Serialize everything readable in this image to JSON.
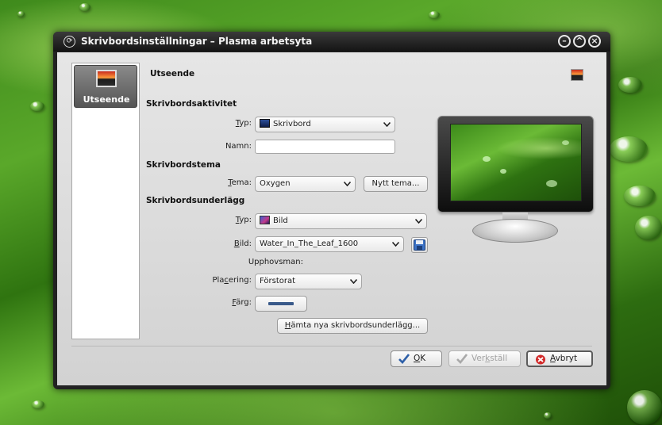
{
  "window": {
    "title": "Skrivbordsinställningar – Plasma arbetsyta",
    "controls": [
      "minimize",
      "maximize",
      "close"
    ]
  },
  "sidebar": {
    "items": [
      {
        "label": "Utseende",
        "icon": "monitor-sunset-icon",
        "selected": true
      }
    ]
  },
  "page": {
    "heading": "Utseende"
  },
  "activity": {
    "section": "Skrivbordsaktivitet",
    "type_label_u": "T",
    "type_label_rest": "yp:",
    "type_value": "Skrivbord",
    "name_label": "Namn:",
    "name_value": ""
  },
  "theme": {
    "section": "Skrivbordstema",
    "theme_label_u": "T",
    "theme_label_rest": "ema:",
    "theme_value": "Oxygen",
    "new_theme_button": "Nytt tema..."
  },
  "wallpaper": {
    "section": "Skrivbordsunderlägg",
    "type_label_u": "T",
    "type_label_rest": "yp:",
    "type_value": "Bild",
    "image_label_u": "B",
    "image_label_rest": "ild:",
    "image_value": "Water_In_The_Leaf_1600",
    "author_label": "Upphovsman:",
    "author_value": "",
    "placement_label_before": "Pla",
    "placement_label_u": "c",
    "placement_label_after": "ering:",
    "placement_value": "Förstorat",
    "color_label_u": "F",
    "color_label_rest": "ärg:",
    "color_value": "#3a5a8a",
    "get_new_button_u": "H",
    "get_new_button_rest": "ämta nya skrivbordsunderlägg..."
  },
  "buttons": {
    "ok_u": "O",
    "ok_rest": "K",
    "apply_before": "Ver",
    "apply_u": "k",
    "apply_after": "ställ",
    "cancel_u": "A",
    "cancel_rest": "vbryt"
  },
  "colors": {
    "titlebar": "#1c1c1c",
    "dialog_bg": "#dcdcdc",
    "selection": "#6e6e6e",
    "cancel_icon": "#d22a2a",
    "check_icon": "#2d5fa8"
  }
}
